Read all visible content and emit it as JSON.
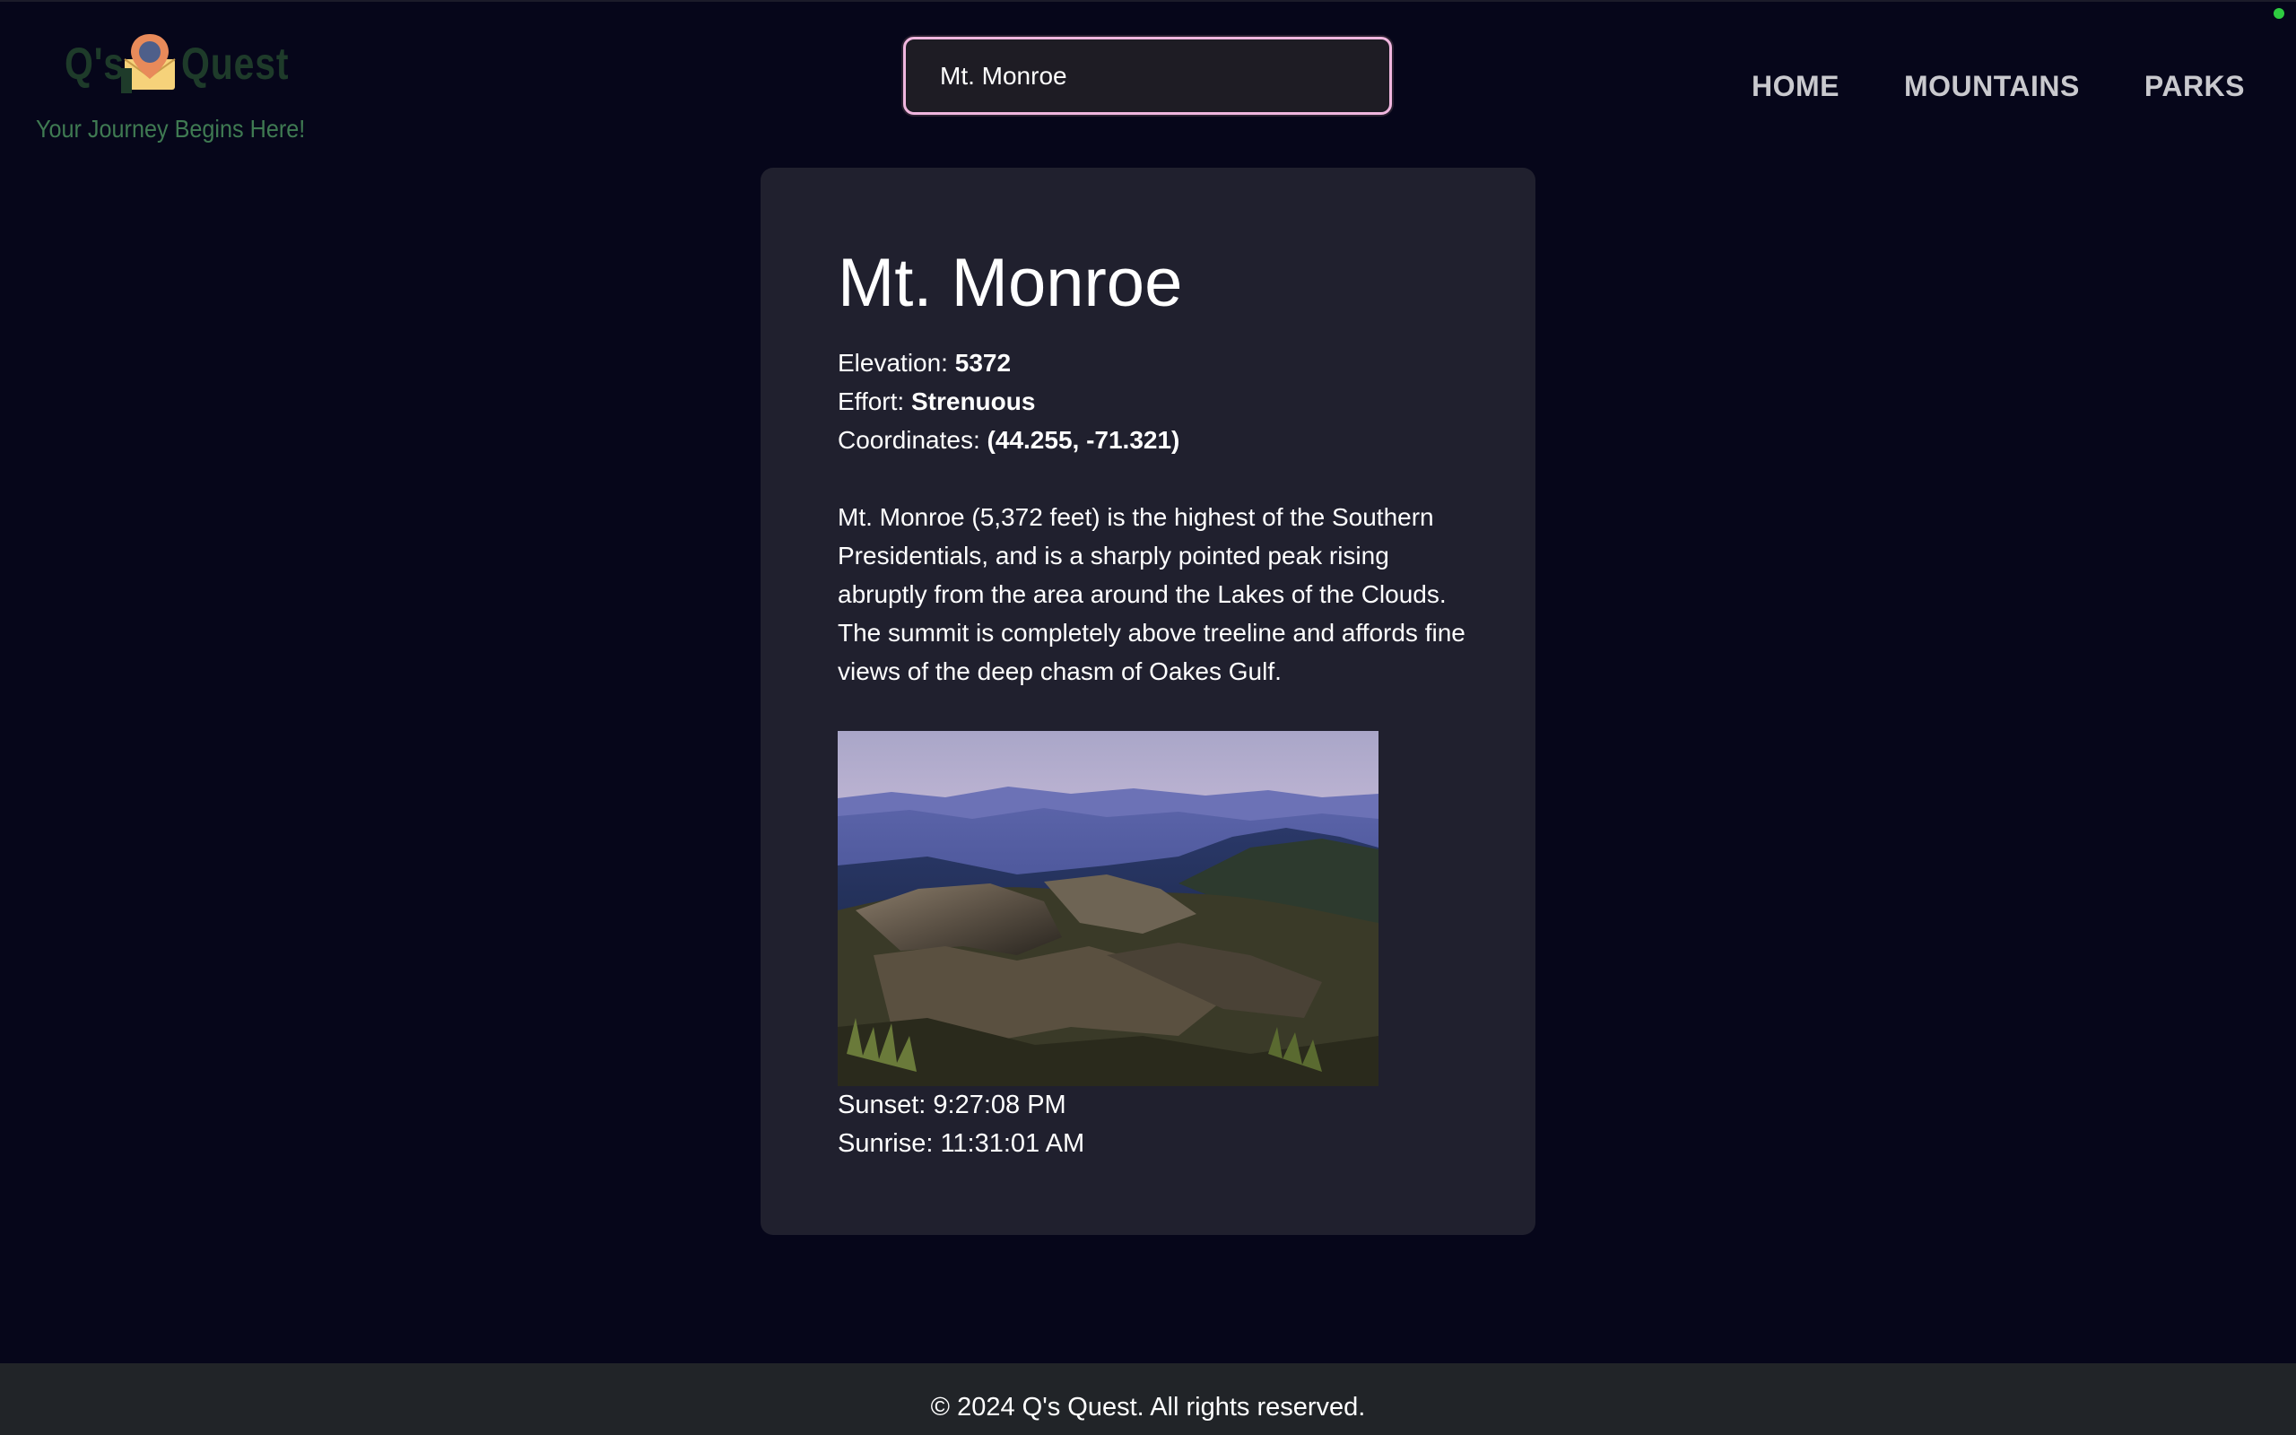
{
  "brand": {
    "logo_left": "Q's",
    "logo_right": "Quest",
    "tagline": "Your Journey Begins Here!"
  },
  "search": {
    "value": "Mt. Monroe",
    "placeholder": ""
  },
  "nav": {
    "items": [
      {
        "label": "HOME"
      },
      {
        "label": "MOUNTAINS"
      },
      {
        "label": "PARKS"
      }
    ]
  },
  "mountain": {
    "name": "Mt. Monroe",
    "elevation_label": "Elevation: ",
    "elevation": "5372",
    "effort_label": "Effort: ",
    "effort": "Strenuous",
    "coordinates_label": "Coordinates: ",
    "coordinates": "(44.255, -71.321)",
    "description": "Mt. Monroe (5,372 feet) is the highest of the Southern Presidentials, and is a sharply pointed peak rising abruptly from the area around the Lakes of the Clouds. The summit is completely above treeline and affords fine views of the deep chasm of Oakes Gulf.",
    "image_icon": "mountain-summit-photo",
    "sunset": "Sunset: 9:27:08 PM",
    "sunrise": "Sunrise: 11:31:01 AM"
  },
  "footer": {
    "text": "© 2024 Q's Quest. All rights reserved."
  },
  "colors": {
    "background": "#06061a",
    "card": "#20202e",
    "search_border": "#f0b6df",
    "logo_text": "#1e3b2a",
    "tagline": "#3f7a52",
    "pin_orange": "#e88a5a",
    "pin_yellow": "#f6d27a",
    "footer": "#212428",
    "status_dot": "#2ecc40"
  }
}
